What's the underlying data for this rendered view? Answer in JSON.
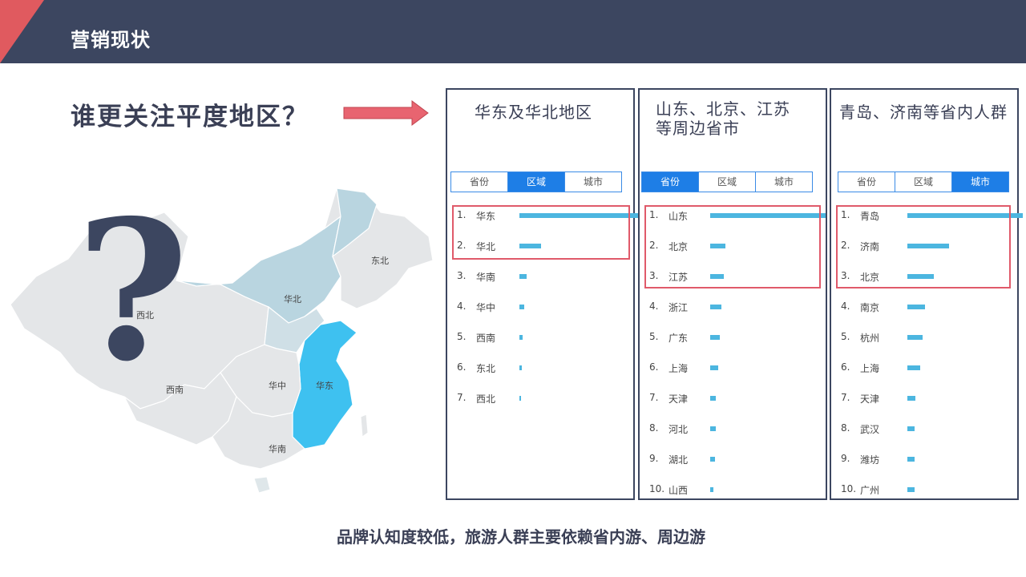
{
  "header": {
    "title": "营销现状"
  },
  "question": "谁更关注平度地区？",
  "map": {
    "region_labels": [
      "东北",
      "华北",
      "西北",
      "西南",
      "华中",
      "华东",
      "华南"
    ],
    "highlight_color": "#3ec1f0",
    "question_mark": "?"
  },
  "panels": [
    {
      "title": "华东及华北地区",
      "tabs": [
        "省份",
        "区域",
        "城市"
      ],
      "active_tab": "区域",
      "rows": [
        {
          "rank": "1.",
          "name": "华东",
          "value": 100
        },
        {
          "rank": "2.",
          "name": "华北",
          "value": 18
        },
        {
          "rank": "3.",
          "name": "华南",
          "value": 6
        },
        {
          "rank": "4.",
          "name": "华中",
          "value": 4
        },
        {
          "rank": "5.",
          "name": "西南",
          "value": 3
        },
        {
          "rank": "6.",
          "name": "东北",
          "value": 2
        },
        {
          "rank": "7.",
          "name": "西北",
          "value": 1
        }
      ]
    },
    {
      "title": "山东、北京、江苏等周边省市",
      "tabs": [
        "省份",
        "区域",
        "城市"
      ],
      "active_tab": "省份",
      "rows": [
        {
          "rank": "1.",
          "name": "山东",
          "value": 100
        },
        {
          "rank": "2.",
          "name": "北京",
          "value": 13
        },
        {
          "rank": "3.",
          "name": "江苏",
          "value": 12
        },
        {
          "rank": "4.",
          "name": "浙江",
          "value": 10
        },
        {
          "rank": "5.",
          "name": "广东",
          "value": 8
        },
        {
          "rank": "6.",
          "name": "上海",
          "value": 7
        },
        {
          "rank": "7.",
          "name": "天津",
          "value": 5
        },
        {
          "rank": "8.",
          "name": "河北",
          "value": 5
        },
        {
          "rank": "9.",
          "name": "湖北",
          "value": 4
        },
        {
          "rank": "10.",
          "name": "山西",
          "value": 3
        }
      ]
    },
    {
      "title": "青岛、济南等省内人群",
      "tabs": [
        "省份",
        "区域",
        "城市"
      ],
      "active_tab": "城市",
      "rows": [
        {
          "rank": "1.",
          "name": "青岛",
          "value": 100
        },
        {
          "rank": "2.",
          "name": "济南",
          "value": 36
        },
        {
          "rank": "3.",
          "name": "北京",
          "value": 23
        },
        {
          "rank": "4.",
          "name": "南京",
          "value": 15
        },
        {
          "rank": "5.",
          "name": "杭州",
          "value": 13
        },
        {
          "rank": "6.",
          "name": "上海",
          "value": 11
        },
        {
          "rank": "7.",
          "name": "天津",
          "value": 7
        },
        {
          "rank": "8.",
          "name": "武汉",
          "value": 6
        },
        {
          "rank": "9.",
          "name": "潍坊",
          "value": 6
        },
        {
          "rank": "10.",
          "name": "广州",
          "value": 6
        }
      ]
    }
  ],
  "footer": {
    "text": "品牌认知度较低，旅游人群主要依赖省内游、周边游"
  },
  "colors": {
    "header_bg": "#3c4660",
    "accent_red": "#e05a5f",
    "bar": "#4cb6e0",
    "tab_active": "#1e7ee6"
  }
}
